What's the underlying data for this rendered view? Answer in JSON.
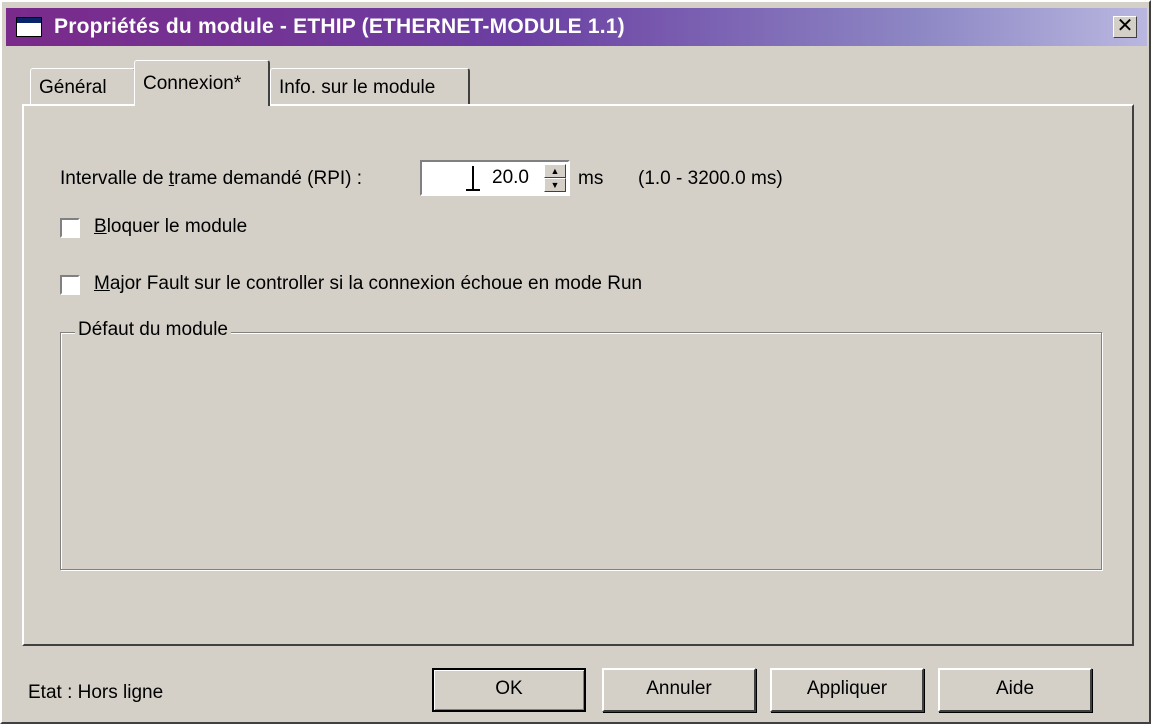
{
  "window": {
    "title": "Propriétés du module  - ETHIP (ETHERNET-MODULE 1.1)",
    "close_label": "✕"
  },
  "tabs": [
    {
      "label": "Général",
      "active": false
    },
    {
      "label": "Connexion*",
      "active": true
    },
    {
      "label": "Info. sur le module",
      "active": false
    }
  ],
  "connection": {
    "rpi_label_before": "Intervalle de ",
    "rpi_label_mnemonic": "t",
    "rpi_label_after": "rame demandé (RPI) :",
    "rpi_value": "20.0",
    "rpi_unit": "ms",
    "rpi_range": "(1.0 - 3200.0 ms)",
    "inhibit_mnemonic": "B",
    "inhibit_label": "loquer le module",
    "inhibit_checked": false,
    "major_fault_mnemonic": "M",
    "major_fault_label": "ajor Fault sur le controller si la connexion échoue en mode Run",
    "major_fault_checked": false,
    "module_fault_group": "Défaut du module"
  },
  "status": {
    "text": "Etat :  Hors ligne"
  },
  "buttons": {
    "ok": "OK",
    "cancel": "Annuler",
    "apply": "Appliquer",
    "help": "Aide"
  }
}
